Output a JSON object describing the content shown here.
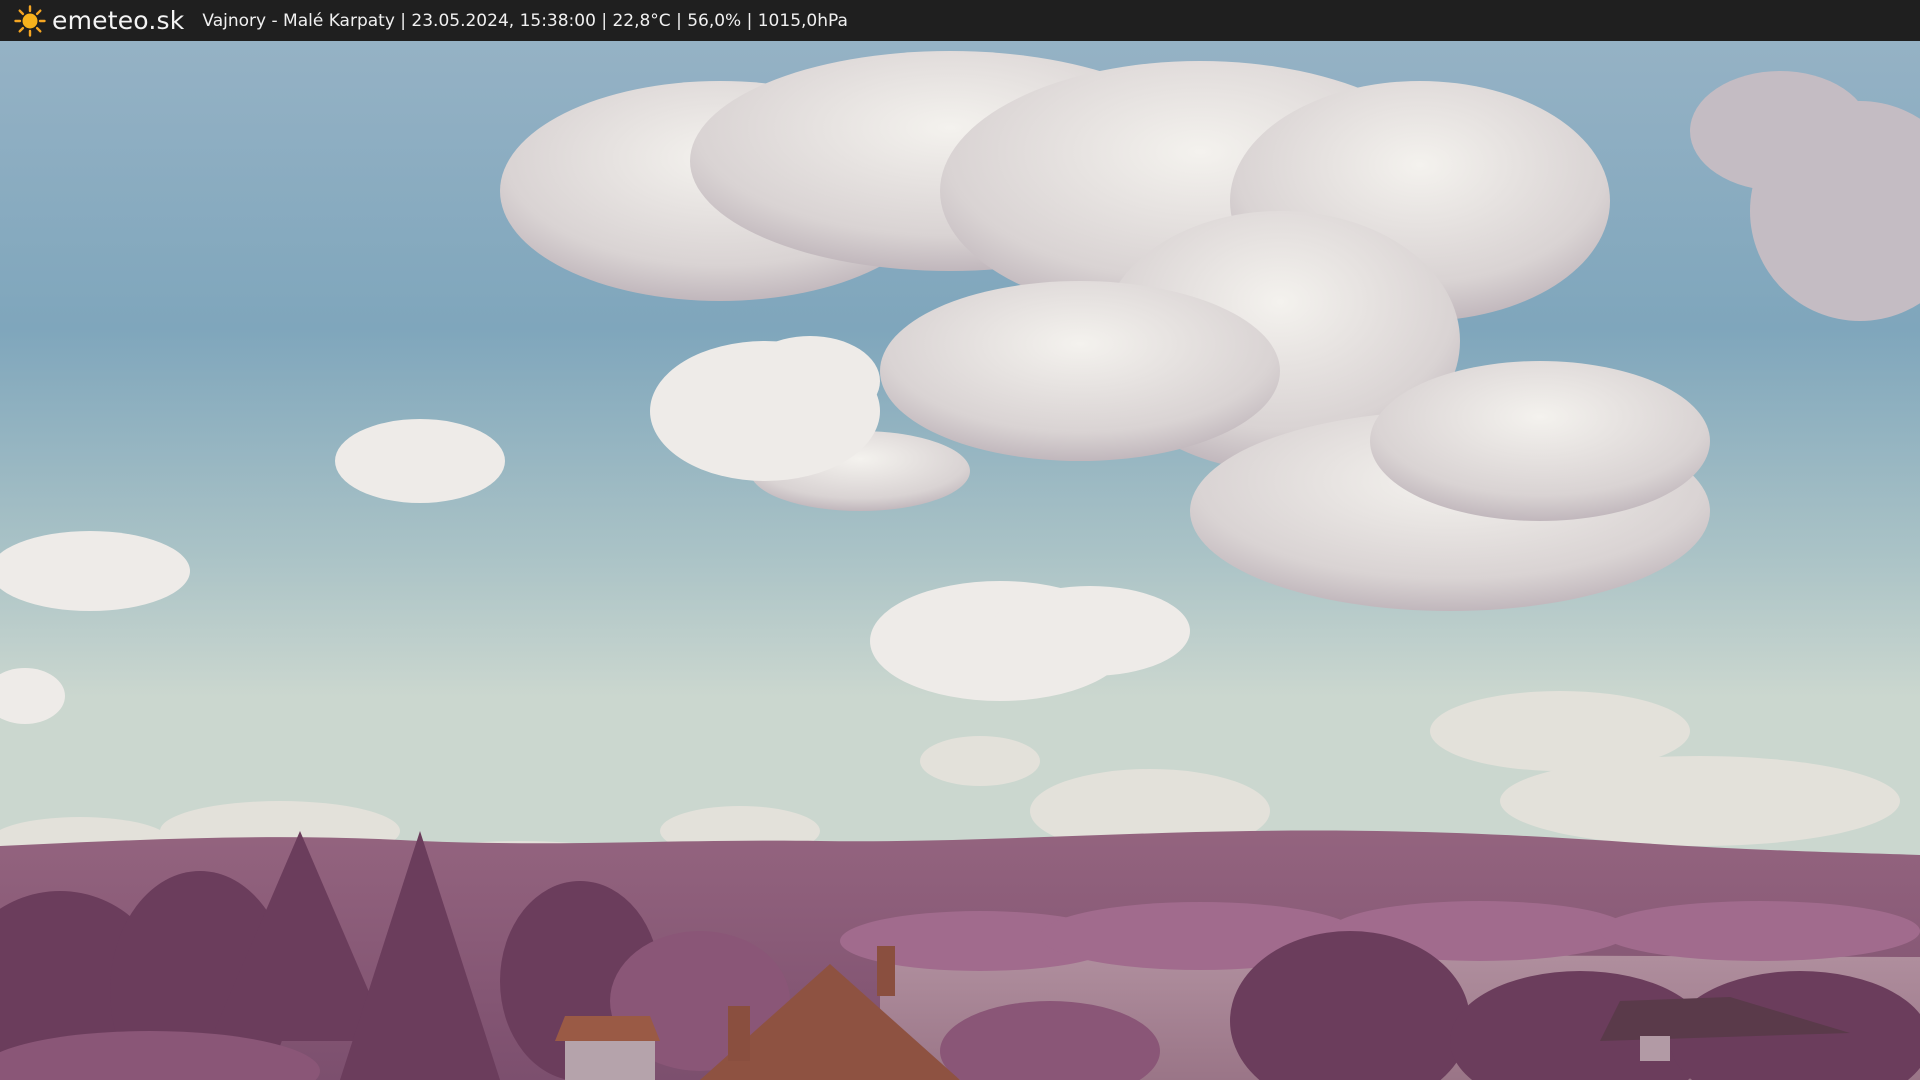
{
  "header": {
    "brand": "emeteo.sk",
    "info": "Vajnory - Malé Karpaty | 23.05.2024, 15:38:00 | 22,8°C | 56,0% | 1015,0hPa"
  },
  "icons": {
    "logo": "sun-icon"
  },
  "colors": {
    "topbar": "#1f1f1f",
    "sun": "#f5a623",
    "sky_top": "#8fb0c4",
    "sky_horizon": "#c9d6cf",
    "hills": "#8a5a7e",
    "trees": "#6e3f5e",
    "roof": "#9a5a45"
  }
}
